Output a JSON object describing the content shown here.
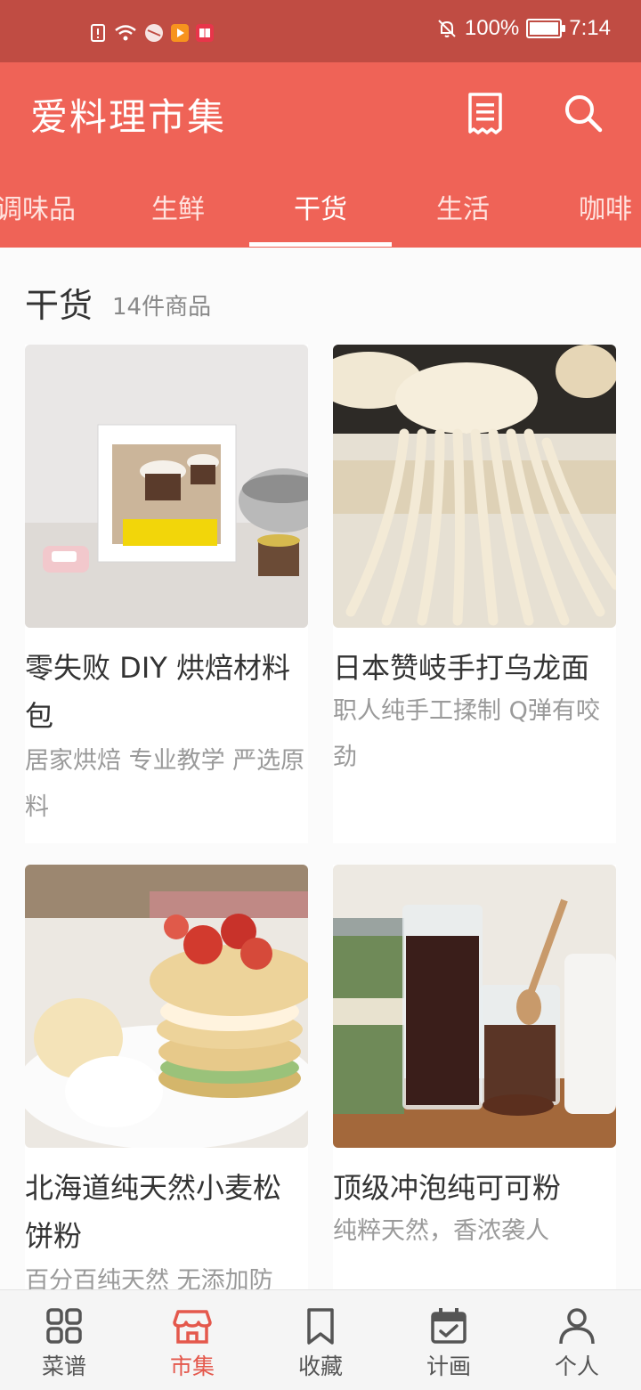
{
  "status_bar": {
    "battery": "100%",
    "time": "7:14"
  },
  "app_bar": {
    "title": "爱料理市集",
    "receipt_icon": "receipt-icon",
    "search_icon": "search-icon"
  },
  "tabs": [
    {
      "label": "调味品",
      "active": false
    },
    {
      "label": "生鲜",
      "active": false
    },
    {
      "label": "干货",
      "active": true
    },
    {
      "label": "生活",
      "active": false
    },
    {
      "label": "咖啡",
      "active": false
    }
  ],
  "section": {
    "title": "干货",
    "count": "14件商品"
  },
  "products": [
    {
      "title": "零失败 DIY 烘焙材料包",
      "desc": "居家烘焙 专业教学 严选原料",
      "image": "baking-kit-photo"
    },
    {
      "title": "日本赞岐手打乌龙面",
      "desc": "职人纯手工揉制 Q弹有咬劲",
      "image": "udon-noodles-photo"
    },
    {
      "title": "北海道纯天然小麦松饼粉",
      "desc": "百分百纯天然 无添加防",
      "image": "pancake-photo"
    },
    {
      "title": "顶级冲泡纯可可粉",
      "desc": "纯粹天然，香浓袭人",
      "image": "cocoa-photo"
    }
  ],
  "bottom_nav": [
    {
      "label": "菜谱",
      "icon": "grid-icon",
      "active": false
    },
    {
      "label": "市集",
      "icon": "store-icon",
      "active": true
    },
    {
      "label": "收藏",
      "icon": "bookmark-icon",
      "active": false
    },
    {
      "label": "计画",
      "icon": "calendar-icon",
      "active": false
    },
    {
      "label": "个人",
      "icon": "person-icon",
      "active": false
    }
  ],
  "colors": {
    "status_bar": "#c04c43",
    "primary": "#ef6357",
    "nav_active": "#e4584c"
  }
}
